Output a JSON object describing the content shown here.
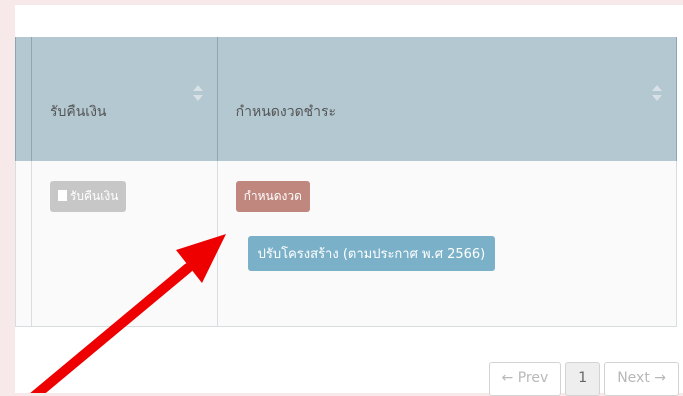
{
  "table": {
    "headers": {
      "refund": "รับคืนเงิน",
      "installment": "กำหนดงวดชำระ"
    },
    "row": {
      "refund_button": "รับคืนเงิน",
      "schedule_badge": "กำหนดงวด",
      "restructure_badge": "ปรับโครงสร้าง (ตามประกาศ พ.ศ 2566)"
    }
  },
  "pagination": {
    "prev": "← Prev",
    "page": "1",
    "next": "Next →"
  },
  "colors": {
    "header_bg": "#b3c8d1",
    "schedule_badge": "#c0877e",
    "restructure_badge": "#7bb1c8",
    "annotation_arrow": "#ee0000"
  },
  "annotation": {
    "icon": "red-arrow-pointer"
  }
}
